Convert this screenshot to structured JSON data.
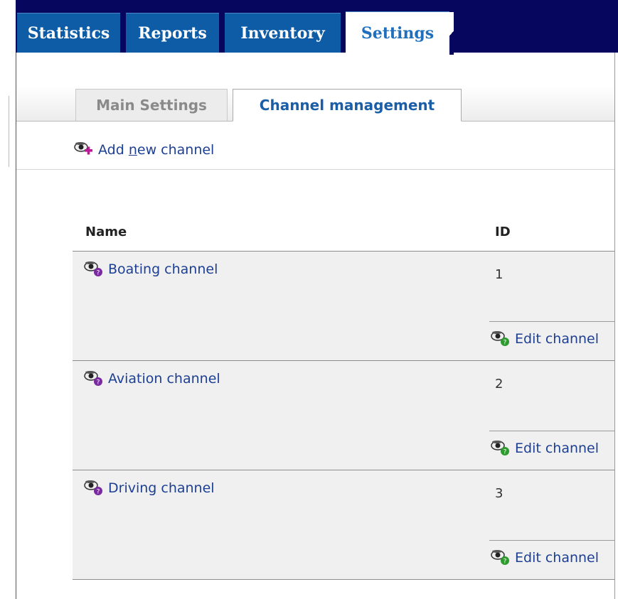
{
  "top_tabs": [
    {
      "label": "Statistics"
    },
    {
      "label": "Reports"
    },
    {
      "label": "Inventory"
    },
    {
      "label": "Settings",
      "active": true
    }
  ],
  "sub_tabs": [
    {
      "label": "Main Settings"
    },
    {
      "label": "Channel management",
      "active": true
    }
  ],
  "add_link": {
    "label": "Add new channel",
    "underlined_letter": "n",
    "icon": "eye-plus-icon"
  },
  "table": {
    "headers": {
      "name": "Name",
      "id": "ID"
    },
    "rows": [
      {
        "name": "Boating channel",
        "id": "1",
        "edit": "Edit channel"
      },
      {
        "name": "Aviation channel",
        "id": "2",
        "edit": "Edit channel"
      },
      {
        "name": "Driving channel",
        "id": "3",
        "edit": "Edit channel"
      }
    ]
  },
  "colors": {
    "top_bar": "#07065f",
    "tab": "#0e5ba6",
    "link": "#1d3f93",
    "row_bg": "#f0f0f0",
    "magenta_badge": "#c0169a",
    "purple_badge": "#7a2aa0",
    "green_badge": "#2e9a2e"
  }
}
